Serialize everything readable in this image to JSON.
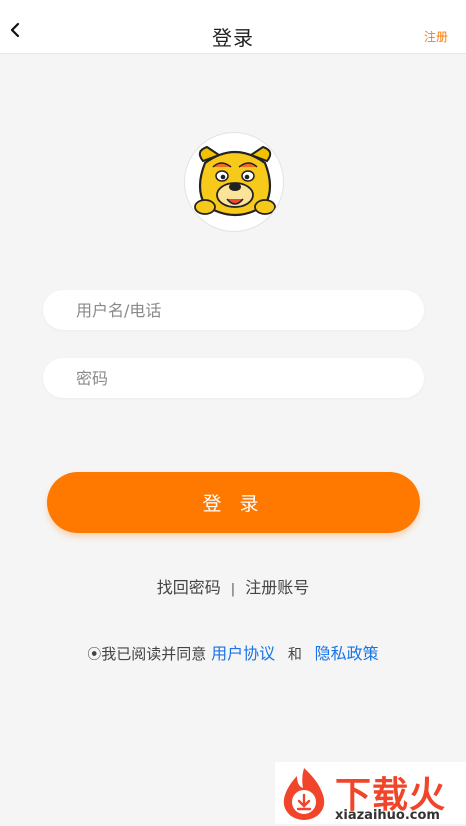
{
  "header": {
    "title": "登录",
    "register_label": "注册",
    "back_icon": "chevron-left-icon"
  },
  "form": {
    "username_placeholder": "用户名/电话",
    "password_placeholder": "密码",
    "login_label": "登 录"
  },
  "links": {
    "forgot_password": "找回密码",
    "separator": "|",
    "register_account": "注册账号"
  },
  "agreement": {
    "radio_glyph": "⦿",
    "prefix": "我已阅读并同意",
    "user_agreement": "用户协议",
    "and": "和",
    "privacy_policy": "隐私政策"
  },
  "watermark": {
    "brand": "下载火",
    "url": "xiazaihuo.com"
  },
  "colors": {
    "accent": "#ff7800",
    "link_blue": "#1a73e8",
    "background": "#f5f5f5"
  }
}
